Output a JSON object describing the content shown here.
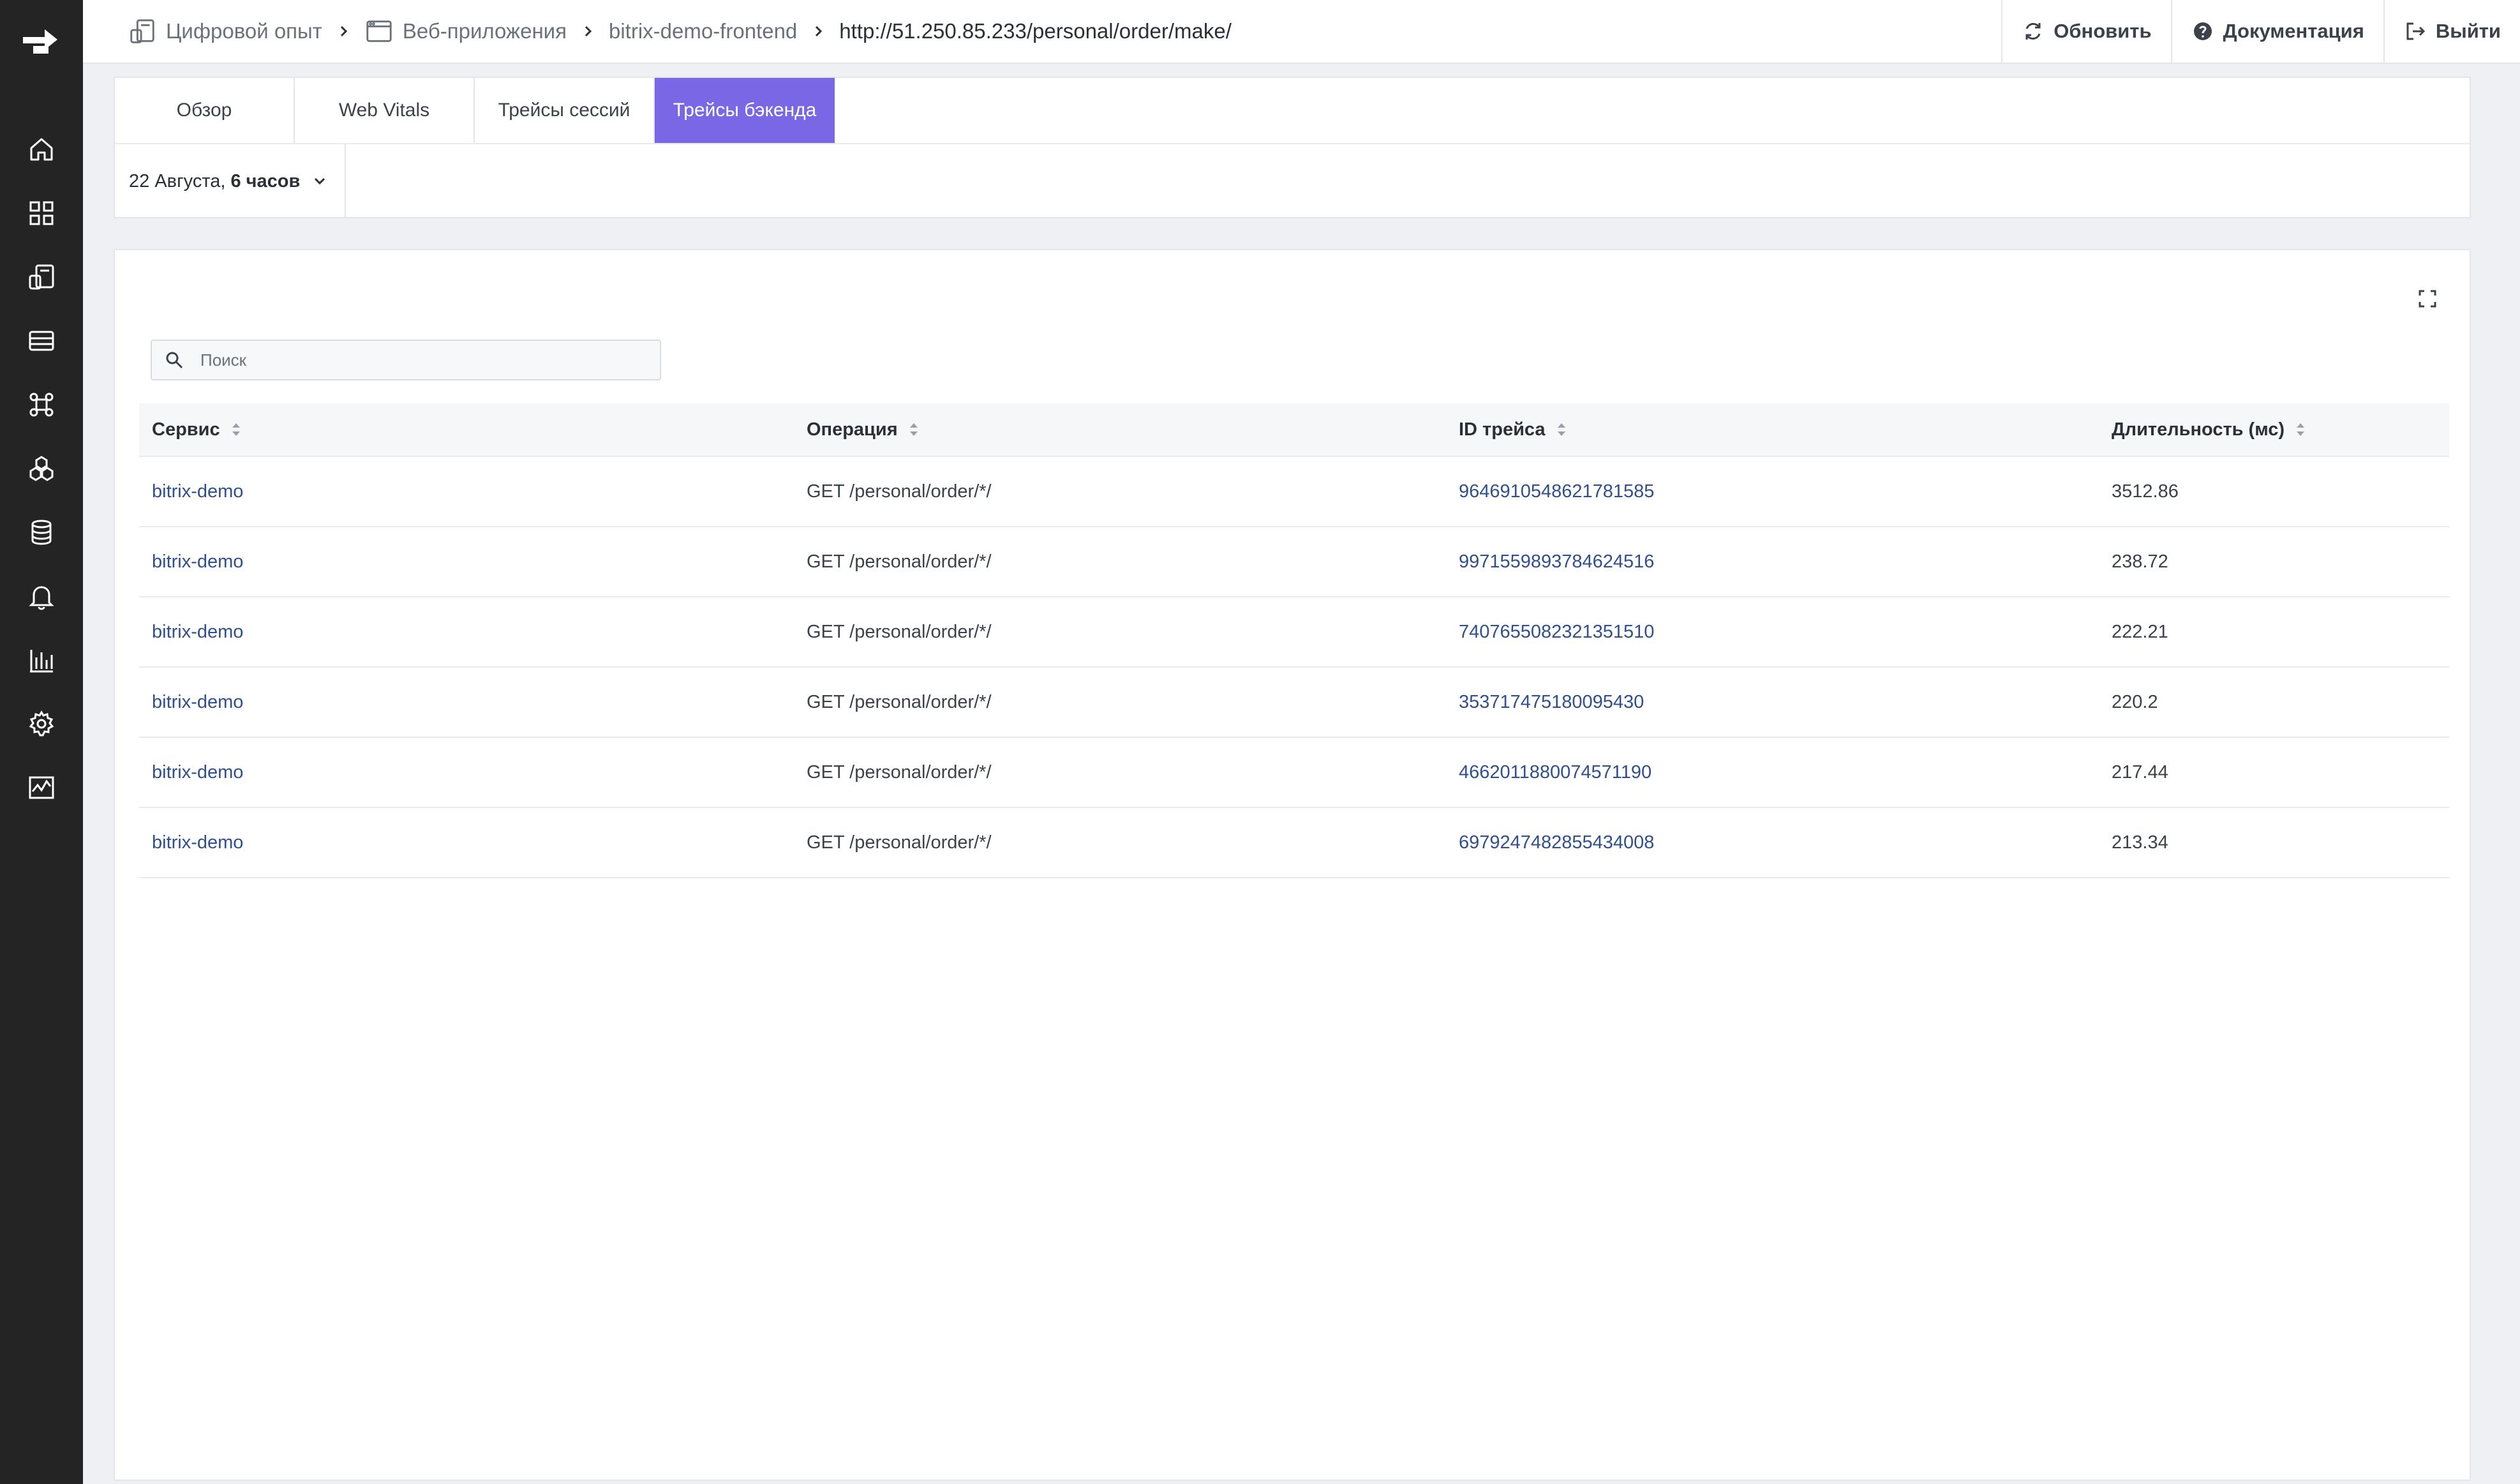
{
  "breadcrumbs": [
    {
      "label": "Цифровой опыт",
      "icon": "digital-experience-icon"
    },
    {
      "label": "Веб-приложения",
      "icon": "browser-window-icon"
    },
    {
      "label": "bitrix-demo-frontend"
    },
    {
      "label": "http://51.250.85.233/personal/order/make/"
    }
  ],
  "top_actions": {
    "refresh": "Обновить",
    "docs": "Документация",
    "logout": "Выйти"
  },
  "tabs": [
    {
      "label": "Обзор",
      "active": false
    },
    {
      "label": "Web Vitals",
      "active": false
    },
    {
      "label": "Трейсы сессий",
      "active": false
    },
    {
      "label": "Трейсы бэкенда",
      "active": true
    }
  ],
  "date_range": {
    "date": "22 Августа,",
    "duration": "6 часов"
  },
  "search": {
    "placeholder": "Поиск",
    "value": ""
  },
  "table": {
    "columns": [
      "Сервис",
      "Операция",
      "ID трейса",
      "Длительность (мс)"
    ],
    "rows": [
      {
        "service": "bitrix-demo",
        "operation": "GET /personal/order/*/",
        "trace_id": "9646910548621781585",
        "duration": "3512.86"
      },
      {
        "service": "bitrix-demo",
        "operation": "GET /personal/order/*/",
        "trace_id": "9971559893784624516",
        "duration": "238.72"
      },
      {
        "service": "bitrix-demo",
        "operation": "GET /personal/order/*/",
        "trace_id": "7407655082321351510",
        "duration": "222.21"
      },
      {
        "service": "bitrix-demo",
        "operation": "GET /personal/order/*/",
        "trace_id": "353717475180095430",
        "duration": "220.2"
      },
      {
        "service": "bitrix-demo",
        "operation": "GET /personal/order/*/",
        "trace_id": "4662011880074571190",
        "duration": "217.44"
      },
      {
        "service": "bitrix-demo",
        "operation": "GET /personal/order/*/",
        "trace_id": "6979247482855434008",
        "duration": "213.34"
      }
    ]
  },
  "colors": {
    "sidebar_bg": "#242424",
    "accent": "#7a67e6",
    "link": "#2f4f8f"
  },
  "sidebar_icons": [
    "home-icon",
    "dashboard-grid-icon",
    "digital-experience-icon",
    "server-list-icon",
    "services-icon",
    "hexagons-icon",
    "database-icon",
    "bell-icon",
    "bar-chart-icon",
    "settings-gear-icon",
    "activity-graph-icon"
  ]
}
